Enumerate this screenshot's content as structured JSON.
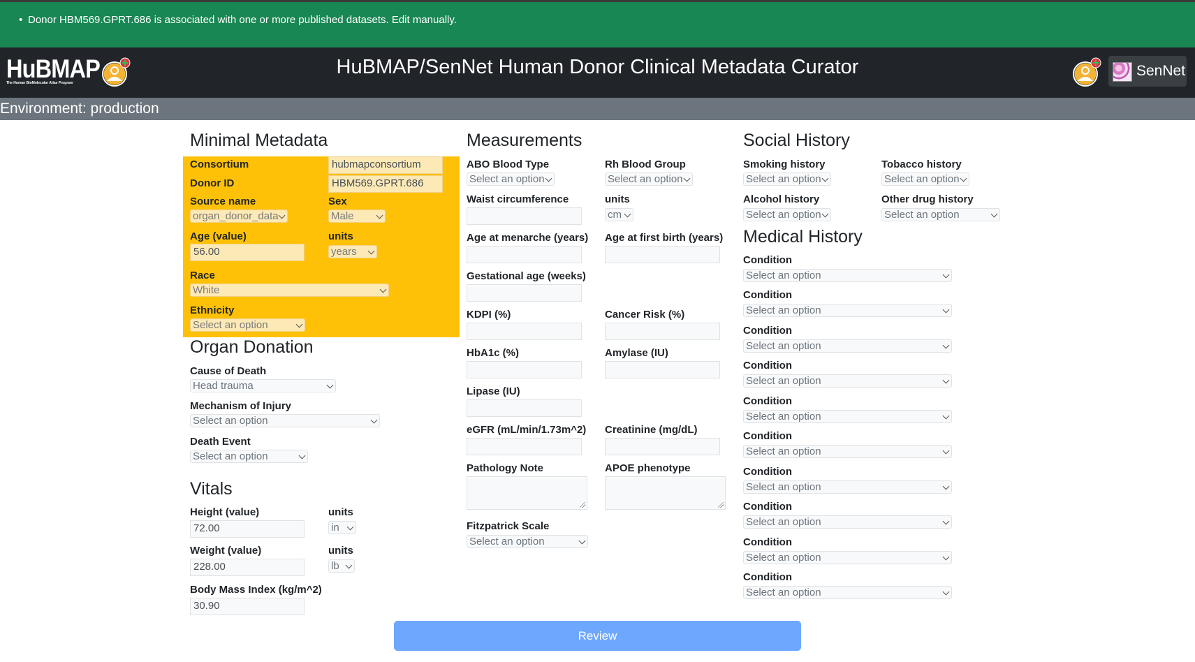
{
  "alert": {
    "message": "Donor HBM569.GPRT.686 is associated with one or more published datasets. Edit manually."
  },
  "navbar": {
    "logo_text": "HuBMAP",
    "logo_subtext": "The Human BioMolecular Atlas Program",
    "title": "HuBMAP/SenNet Human Donor Clinical Metadata Curator",
    "sennet_label": "SenNet"
  },
  "env": {
    "label": "Environment: production"
  },
  "minimal": {
    "heading": "Minimal Metadata",
    "consortium_label": "Consortium",
    "consortium_value": "hubmapconsortium",
    "donor_id_label": "Donor ID",
    "donor_id_value": "HBM569.GPRT.686",
    "source_name_label": "Source name",
    "source_name_value": "organ_donor_data",
    "sex_label": "Sex",
    "sex_value": "Male",
    "age_label": "Age (value)",
    "age_value": "56.00",
    "age_units_label": "units",
    "age_units_value": "years",
    "race_label": "Race",
    "race_value": "White",
    "ethnicity_label": "Ethnicity",
    "ethnicity_value": "Select an option"
  },
  "organ": {
    "heading": "Organ Donation",
    "cause_label": "Cause of Death",
    "cause_value": "Head trauma",
    "mechanism_label": "Mechanism of Injury",
    "mechanism_value": "Select an option",
    "death_event_label": "Death Event",
    "death_event_value": "Select an option"
  },
  "vitals": {
    "heading": "Vitals",
    "height_label": "Height (value)",
    "height_value": "72.00",
    "height_units_label": "units",
    "height_units_value": "in",
    "weight_label": "Weight (value)",
    "weight_value": "228.00",
    "weight_units_label": "units",
    "weight_units_value": "lb",
    "bmi_label": "Body Mass Index (kg/m^2)",
    "bmi_value": "30.90"
  },
  "measurements": {
    "heading": "Measurements",
    "abo_label": "ABO Blood Type",
    "abo_value": "Select an option",
    "rh_label": "Rh Blood Group",
    "rh_value": "Select an option",
    "waist_label": "Waist circumference",
    "waist_units_label": "units",
    "waist_units_value": "cm",
    "menarche_label": "Age at menarche (years)",
    "first_birth_label": "Age at first birth (years)",
    "gestational_label": "Gestational age (weeks)",
    "kdpi_label": "KDPI (%)",
    "cancer_label": "Cancer Risk (%)",
    "hba1c_label": "HbA1c (%)",
    "amylase_label": "Amylase (IU)",
    "lipase_label": "Lipase (IU)",
    "egfr_label": "eGFR (mL/min/1.73m^2)",
    "creatinine_label": "Creatinine (mg/dL)",
    "pathology_label": "Pathology Note",
    "apoe_label": "APOE phenotype",
    "fitz_label": "Fitzpatrick Scale",
    "fitz_value": "Select an option"
  },
  "social": {
    "heading": "Social History",
    "smoking_label": "Smoking history",
    "smoking_value": "Select an option",
    "tobacco_label": "Tobacco history",
    "tobacco_value": "Select an option",
    "alcohol_label": "Alcohol history",
    "alcohol_value": "Select an option",
    "other_drug_label": "Other drug history",
    "other_drug_value": "Select an option"
  },
  "medical": {
    "heading": "Medical History",
    "conditions": [
      {
        "label": "Condition",
        "value": "Select an option"
      },
      {
        "label": "Condition",
        "value": "Select an option"
      },
      {
        "label": "Condition",
        "value": "Select an option"
      },
      {
        "label": "Condition",
        "value": "Select an option"
      },
      {
        "label": "Condition",
        "value": "Select an option"
      },
      {
        "label": "Condition",
        "value": "Select an option"
      },
      {
        "label": "Condition",
        "value": "Select an option"
      },
      {
        "label": "Condition",
        "value": "Select an option"
      },
      {
        "label": "Condition",
        "value": "Select an option"
      },
      {
        "label": "Condition",
        "value": "Select an option"
      }
    ]
  },
  "review_label": "Review",
  "colors": {
    "alert_bg": "#198754",
    "navbar_bg": "#212529",
    "env_bg": "#6c757d",
    "required_bg": "#ffc107",
    "review_bg": "#6ea8fe"
  },
  "icons": [
    "user-add-icon",
    "chevron-down-icon",
    "resize-grip-icon"
  ]
}
